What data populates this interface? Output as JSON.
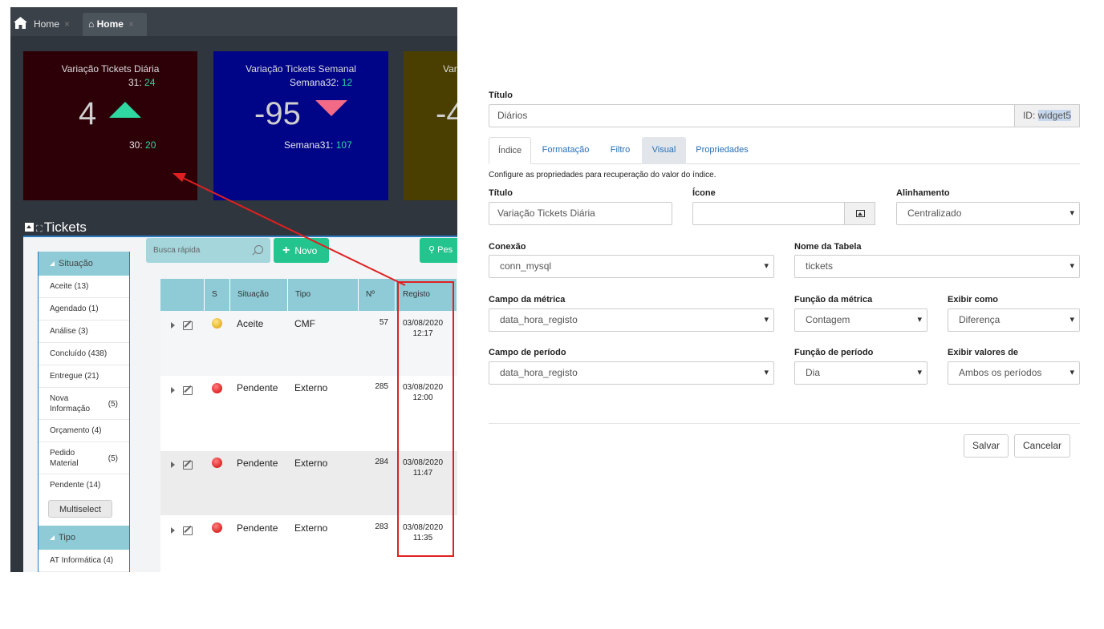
{
  "left": {
    "tabs": [
      {
        "label": "Home",
        "close": "×"
      },
      {
        "label": "Home",
        "close": "×"
      }
    ],
    "widgets": [
      {
        "title": "Variação Tickets Diária",
        "top_label": "31:",
        "top_value": "24",
        "big": "4",
        "bottom_label": "30:",
        "bottom_value": "20",
        "trend_color": "#2ed8a0"
      },
      {
        "title": "Variação Tickets Semanal",
        "top_label": "Semana32:",
        "top_value": "12",
        "big": "-95",
        "bottom_label": "Semana31:",
        "bottom_value": "107",
        "trend_color": "#f36a86"
      },
      {
        "title": "Vari",
        "big": "-4"
      }
    ],
    "section_title": "Tickets",
    "sidebar": {
      "group1": "Situação",
      "items": [
        {
          "label": "Aceite (13)"
        },
        {
          "label": "Agendado (1)"
        },
        {
          "label": "Análise (3)"
        },
        {
          "label": "Concluído (438)"
        },
        {
          "label": "Entregue (21)"
        },
        {
          "label": "Nova Informação",
          "count": "(5)"
        },
        {
          "label": "Orçamento (4)"
        },
        {
          "label": "Pedido Material",
          "count": "(5)"
        },
        {
          "label": "Pendente (14)"
        }
      ],
      "multiselect": "Multiselect",
      "group2": "Tipo",
      "item_tipo": "AT Informática (4)"
    },
    "search_placeholder": "Busca rápida",
    "new_button": "Novo",
    "search_button": "Pes",
    "grid": {
      "headers": [
        "S",
        "Situação",
        "Tipo",
        "Nº",
        "Registo"
      ],
      "rows": [
        {
          "status": "yellow",
          "situacao": "Aceite",
          "tipo": "CMF",
          "num": "57",
          "date": "03/08/2020",
          "time": "12:17"
        },
        {
          "status": "red",
          "situacao": "Pendente",
          "tipo": "Externo",
          "num": "285",
          "date": "03/08/2020",
          "time": "12:00"
        },
        {
          "status": "red",
          "situacao": "Pendente",
          "tipo": "Externo",
          "num": "284",
          "date": "03/08/2020",
          "time": "11:47"
        },
        {
          "status": "red",
          "situacao": "Pendente",
          "tipo": "Externo",
          "num": "283",
          "date": "03/08/2020",
          "time": "11:35"
        }
      ]
    }
  },
  "form": {
    "title_label": "Título",
    "title_value": "Diários",
    "id_label": "ID:",
    "id_value": "widget5",
    "tabs": [
      "Índice",
      "Formatação",
      "Filtro",
      "Visual",
      "Propriedades"
    ],
    "hint": "Configure as propriedades para recuperação do valor do índice.",
    "f_titulo_label": "Título",
    "f_titulo_value": "Variação Tickets Diária",
    "f_icone_label": "Ícone",
    "f_alinhamento_label": "Alinhamento",
    "f_alinhamento_value": "Centralizado",
    "f_conexao_label": "Conexão",
    "f_conexao_value": "conn_mysql",
    "f_tabela_label": "Nome da Tabela",
    "f_tabela_value": "tickets",
    "f_campo_metrica_label": "Campo da métrica",
    "f_campo_metrica_value": "data_hora_registo",
    "f_funcao_metrica_label": "Função da métrica",
    "f_funcao_metrica_value": "Contagem",
    "f_exibir_label": "Exibir como",
    "f_exibir_value": "Diferença",
    "f_campo_periodo_label": "Campo de período",
    "f_campo_periodo_value": "data_hora_registo",
    "f_funcao_periodo_label": "Função de período",
    "f_funcao_periodo_value": "Dia",
    "f_exibir_valores_label": "Exibir valores de",
    "f_exibir_valores_value": "Ambos os períodos",
    "save": "Salvar",
    "cancel": "Cancelar"
  }
}
